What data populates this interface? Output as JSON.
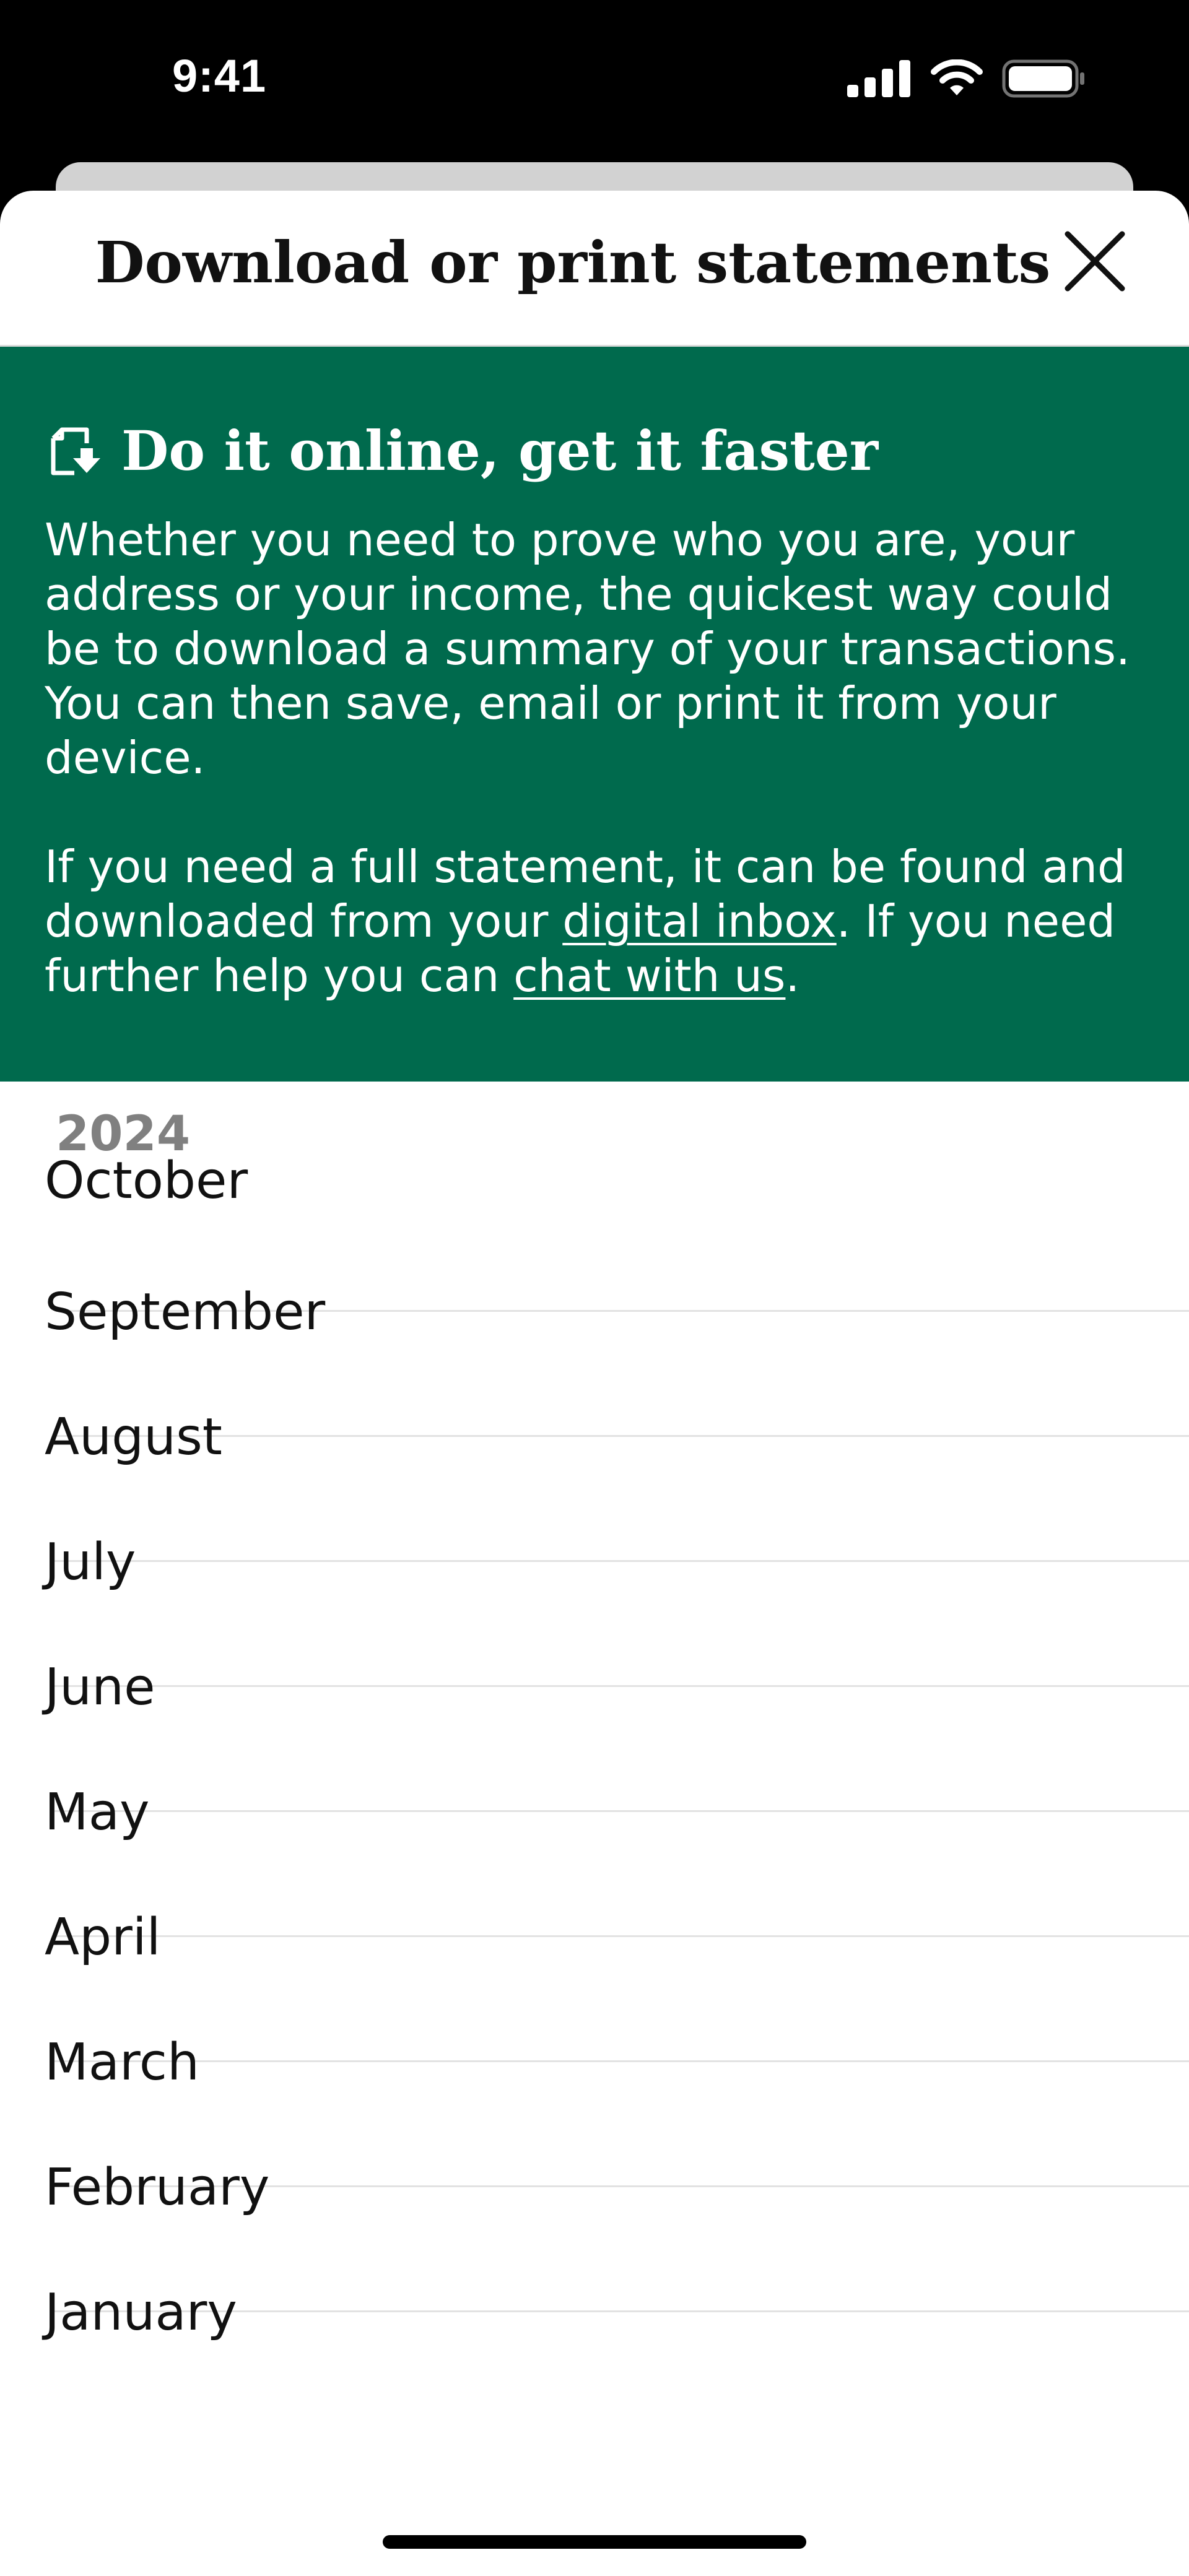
{
  "status_bar": {
    "time": "9:41",
    "icons": [
      "cellular-signal-icon",
      "wifi-icon",
      "battery-icon"
    ]
  },
  "header": {
    "title": "Download or print statements",
    "close_icon": "close-icon"
  },
  "banner": {
    "icon": "download-document-icon",
    "title": "Do it online, get it faster",
    "paragraph1": "Whether you need to prove who you are, your address or your income, the quickest way could be to download a summary of your transactions. You can then save, email or print it from your device.",
    "paragraph2_before": "If you need a full statement, it can be found and downloaded from your ",
    "link_inbox": "digital inbox",
    "paragraph2_middle": ". If you need further help you can ",
    "link_chat": "chat with us",
    "paragraph2_after": ".",
    "background_color": "#006a4d"
  },
  "statements": {
    "year": "2024",
    "months": [
      "October",
      "September",
      "August",
      "July",
      "June",
      "May",
      "April",
      "March",
      "February",
      "January"
    ]
  }
}
